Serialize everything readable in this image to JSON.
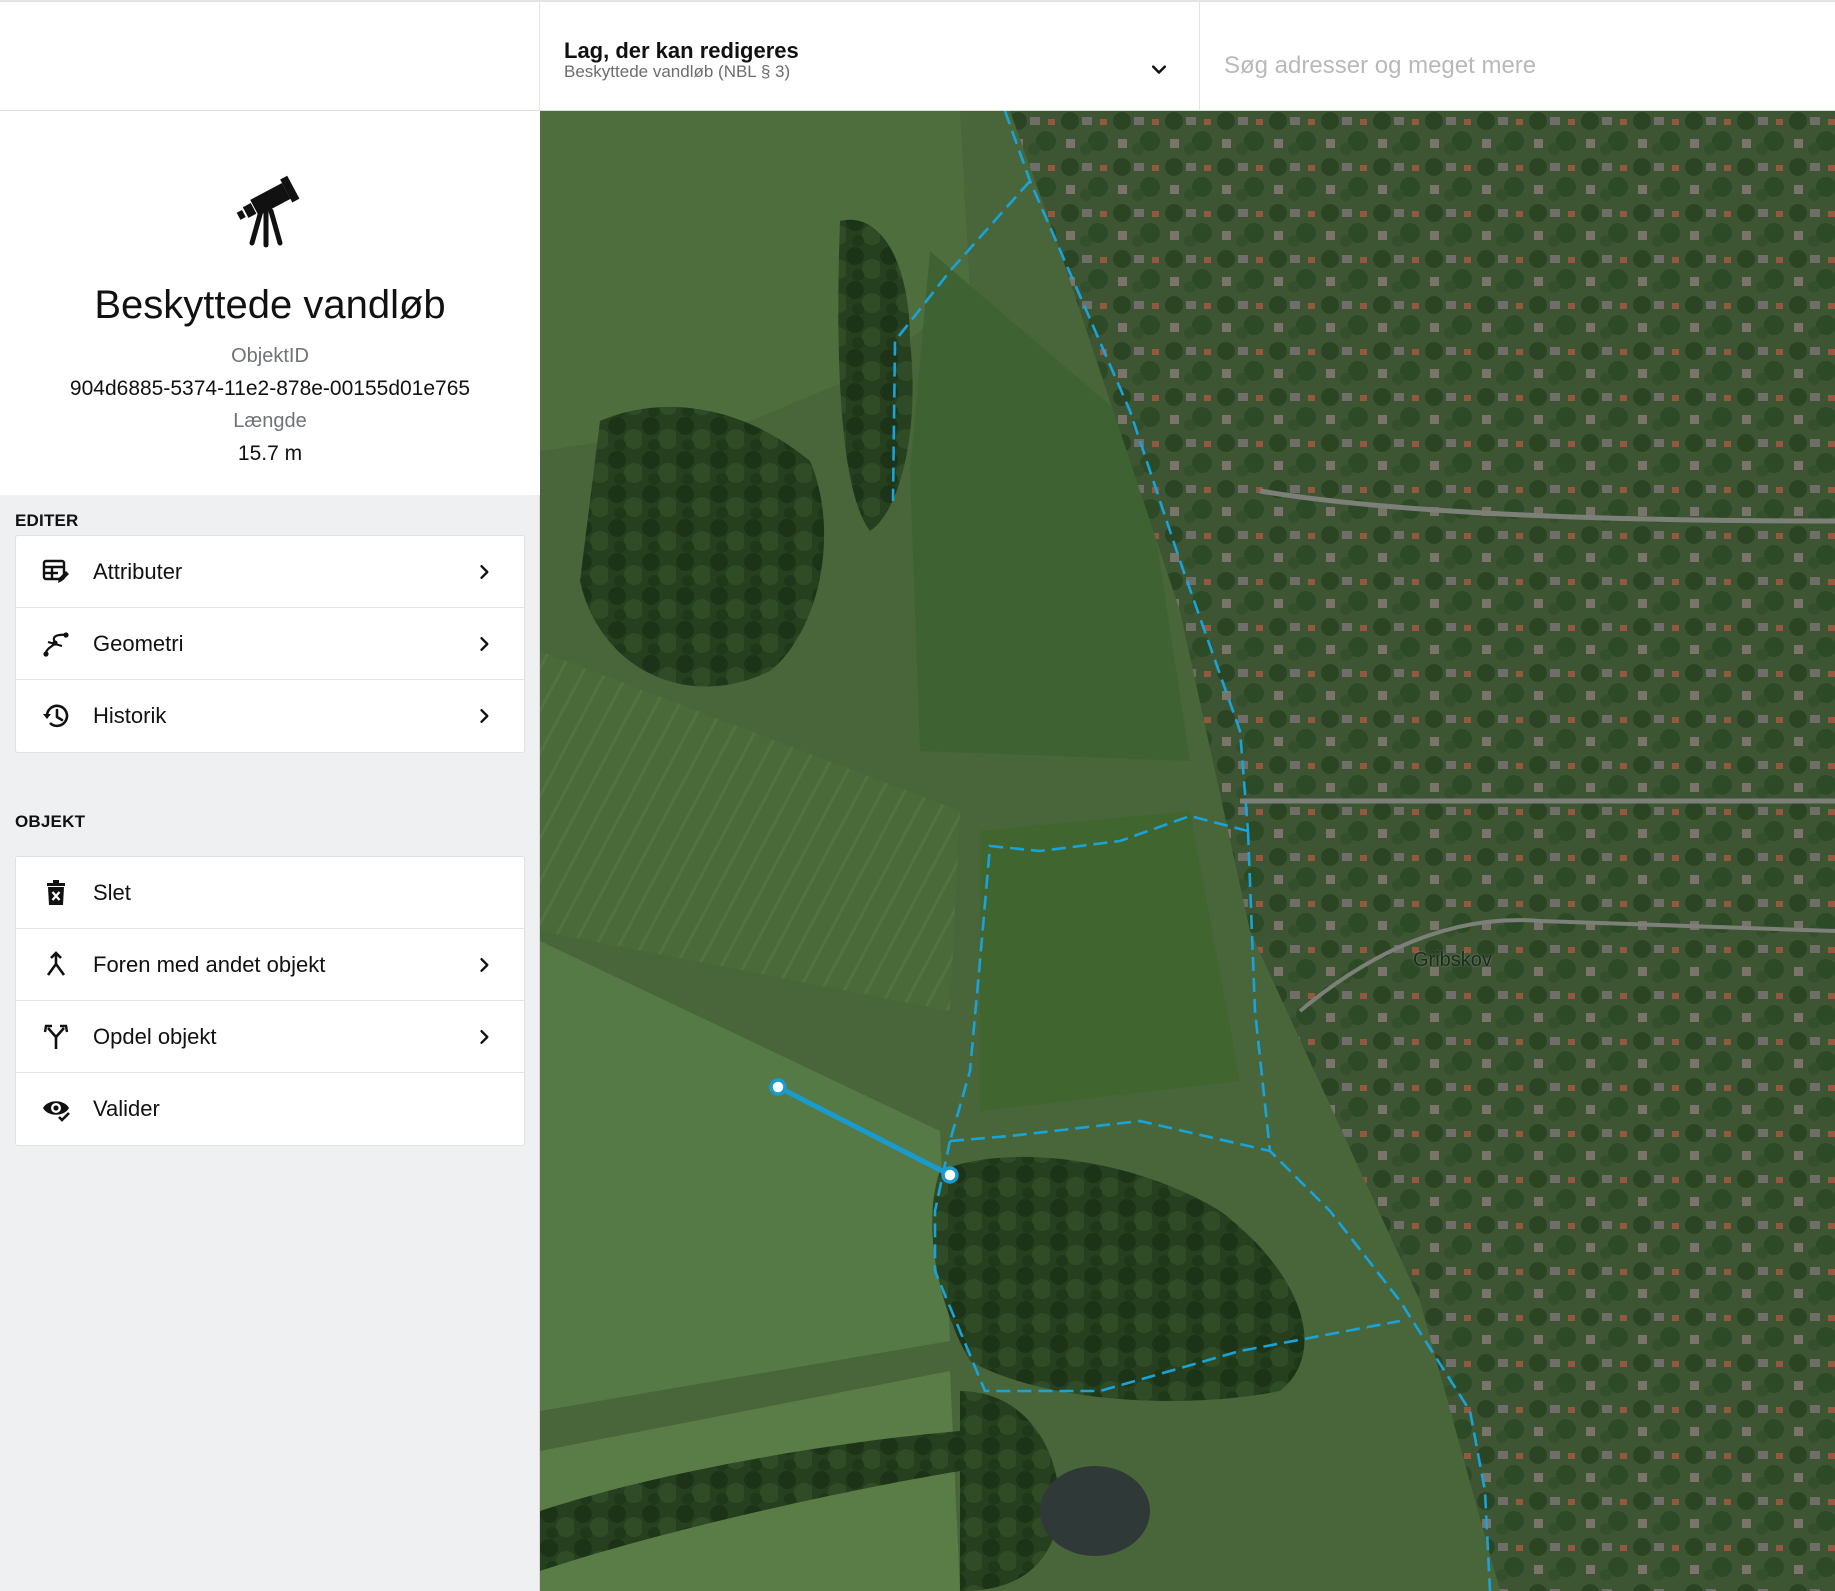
{
  "header": {
    "layer_title": "Lag, der kan redigeres",
    "layer_subtitle": "Beskyttede vandløb (NBL § 3)",
    "search_placeholder": "Søg adresser og meget mere"
  },
  "object": {
    "title": "Beskyttede vandløb",
    "id_label": "ObjektID",
    "id_value": "904d6885-5374-11e2-878e-00155d01e765",
    "length_label": "Længde",
    "length_value": "15.7 m",
    "icon": "telescope-icon"
  },
  "edit_section": {
    "heading": "EDITER",
    "items": [
      {
        "label": "Attributer",
        "icon": "table-edit-icon",
        "chevron": true
      },
      {
        "label": "Geometri",
        "icon": "vector-curve-icon",
        "chevron": true
      },
      {
        "label": "Historik",
        "icon": "history-icon",
        "chevron": true
      }
    ]
  },
  "object_section": {
    "heading": "OBJEKT",
    "items": [
      {
        "label": "Slet",
        "icon": "trash-icon",
        "chevron": false
      },
      {
        "label": "Foren med andet objekt",
        "icon": "merge-icon",
        "chevron": true
      },
      {
        "label": "Opdel objekt",
        "icon": "split-icon",
        "chevron": true
      },
      {
        "label": "Valider",
        "icon": "eye-check-icon",
        "chevron": false
      }
    ]
  },
  "map": {
    "place_label": "Gribskov",
    "layer_line_color": "#1aa3d9",
    "selected_line_color": "#1a9bd0"
  }
}
